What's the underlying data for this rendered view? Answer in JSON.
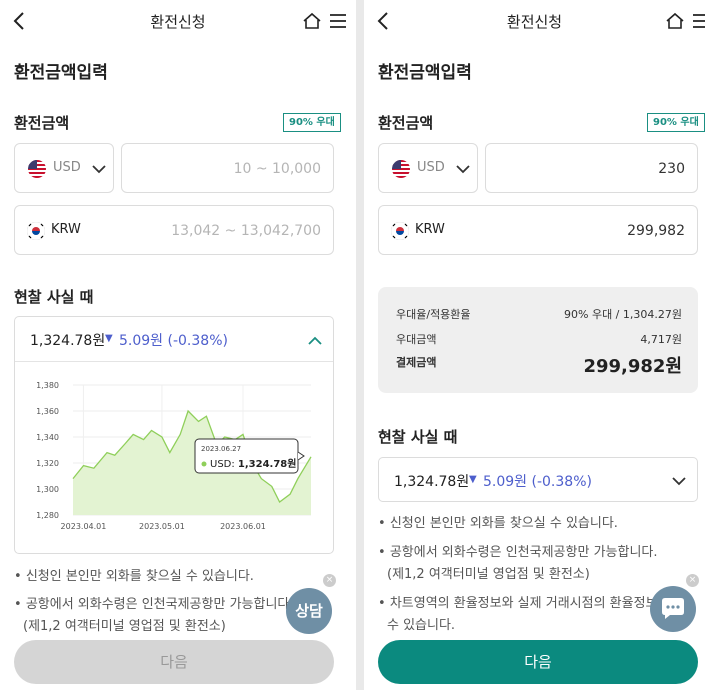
{
  "colors": {
    "brand": "#0b8a7f",
    "badge": "#1a8f82",
    "change_down": "#4d5ecc",
    "cta_disabled": "#d5d5d5",
    "chart_line": "#8fcf5a",
    "chart_fill": "#e3f3d2"
  },
  "left": {
    "header_title": "환전신청",
    "section_title": "환전금액입력",
    "amount_label": "환전금액",
    "badge": "90% 우대",
    "from_currency": "USD",
    "from_placeholder": "10 ~ 10,000",
    "to_currency": "KRW",
    "to_placeholder": "13,042 ~ 13,042,700",
    "cash_label": "현찰 사실 때",
    "rate": "1,324.78원",
    "rate_change": "5.09원 (-0.38%)",
    "tooltip_date": "2023.06.27",
    "tooltip_prefix": "USD:",
    "tooltip_value": "1,324.78원",
    "notices": [
      "신청인 본인만 외화를 찾으실 수 있습니다.",
      "공항에서 외화수령은 인천국제공항만 가능합니다.",
      "(제1,2 여객터미널 영업점 및 환전소)"
    ],
    "fab_label": "상담",
    "fab_close": "×",
    "cta": "다음"
  },
  "right": {
    "header_title": "환전신청",
    "section_title": "환전금액입력",
    "amount_label": "환전금액",
    "badge": "90% 우대",
    "from_currency": "USD",
    "from_value": "230",
    "to_currency": "KRW",
    "to_value": "299,982",
    "summary": {
      "rate_label": "우대율/적용환율",
      "rate_value": "90% 우대 / 1,304.27원",
      "discount_label": "우대금액",
      "discount_value": "4,717원",
      "total_label": "결제금액",
      "total_value": "299,982원"
    },
    "cash_label": "현찰 사실 때",
    "rate": "1,324.78원",
    "rate_change": "5.09원 (-0.38%)",
    "notices": [
      "신청인 본인만 외화를 찾으실 수 있습니다.",
      "공항에서 외화수령은 인천국제공항만 가능합니다.",
      "(제1,2 여객터미널 영업점 및 환전소)",
      "차트영역의 환율정보와 실제 거래시점의 환율정보",
      "수 있습니다."
    ],
    "fab_close": "×",
    "cta": "다음"
  },
  "chart_data": {
    "type": "area",
    "title": "",
    "xlabel": "",
    "ylabel": "",
    "ylim": [
      1280,
      1380
    ],
    "yticks": [
      "1,380",
      "1,360",
      "1,340",
      "1,320",
      "1,300",
      "1,280"
    ],
    "xticks": [
      "2023.04.01",
      "2023.05.01",
      "2023.06.01"
    ],
    "grid": true,
    "series": [
      {
        "x": [
          "2023.03.28",
          "2023.04.01",
          "2023.04.05",
          "2023.04.10",
          "2023.04.13",
          "2023.04.17",
          "2023.04.20",
          "2023.04.24",
          "2023.04.27",
          "2023.05.01",
          "2023.05.04",
          "2023.05.08",
          "2023.05.11",
          "2023.05.15",
          "2023.05.18",
          "2023.05.22",
          "2023.05.25",
          "2023.05.29",
          "2023.06.01",
          "2023.06.05",
          "2023.06.08",
          "2023.06.12",
          "2023.06.15",
          "2023.06.19",
          "2023.06.22",
          "2023.06.27"
        ],
        "values": [
          1308,
          1318,
          1316,
          1328,
          1326,
          1335,
          1342,
          1338,
          1345,
          1340,
          1328,
          1342,
          1360,
          1352,
          1356,
          1334,
          1340,
          1338,
          1342,
          1318,
          1308,
          1302,
          1290,
          1296,
          1308,
          1324.78
        ]
      }
    ]
  }
}
